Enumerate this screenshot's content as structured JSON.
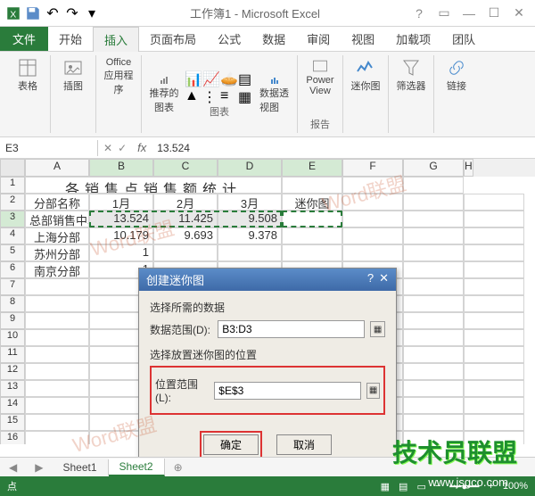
{
  "titlebar": {
    "title": "工作簿1 - Microsoft Excel"
  },
  "menu": {
    "file": "文件",
    "home": "开始",
    "insert": "插入",
    "layout": "页面布局",
    "formula": "公式",
    "data": "数据",
    "review": "审阅",
    "view": "视图",
    "addin": "加载项",
    "team": "团队"
  },
  "ribbon": {
    "tables": "表格",
    "illust": "插图",
    "office_apps": "Office\n应用程序",
    "recommended_charts": "推荐的\n图表",
    "charts": "图表",
    "pivot_chart": "数据透视图",
    "powerview": "Power\nView",
    "reports": "报告",
    "sparklines": "迷你图",
    "filters": "筛选器",
    "links": "链接"
  },
  "formula_bar": {
    "name": "E3",
    "value": "13.524"
  },
  "cols": [
    "A",
    "B",
    "C",
    "D",
    "E",
    "F",
    "G",
    "H"
  ],
  "rows": {
    "r1": {
      "merged": "各销售点销售额统计"
    },
    "r2": {
      "a": "分部名称",
      "b": "1月",
      "c": "2月",
      "d": "3月",
      "e": "迷你图"
    },
    "r3": {
      "a": "总部销售中心",
      "b": "13.524",
      "c": "11.425",
      "d": "9.508"
    },
    "r4": {
      "a": "上海分部",
      "b": "10.179",
      "c": "9.693",
      "d": "9.378"
    },
    "r5": {
      "a": "苏州分部",
      "b": "1"
    },
    "r6": {
      "a": "南京分部",
      "b": "1"
    }
  },
  "dialog": {
    "title": "创建迷你图",
    "section1": "选择所需的数据",
    "field1_label": "数据范围(D):",
    "field1_value": "B3:D3",
    "section2": "选择放置迷你图的位置",
    "field2_label": "位置范围(L):",
    "field2_value": "$E$3",
    "ok": "确定",
    "cancel": "取消"
  },
  "sheettabs": {
    "s1": "Sheet1",
    "s2": "Sheet2"
  },
  "statusbar": {
    "left": "点",
    "zoom": "100%"
  },
  "watermark": "Word联盟",
  "brand": "技术员联盟",
  "url": "www.jsgco.com"
}
